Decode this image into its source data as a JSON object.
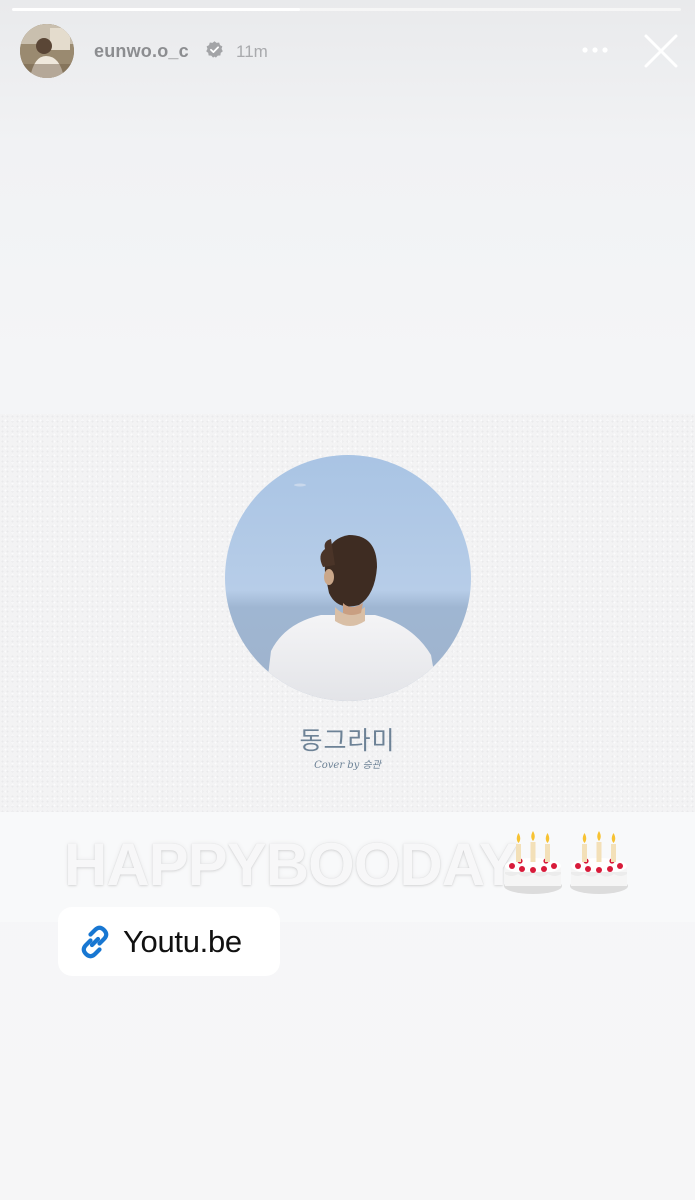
{
  "story": {
    "progress": 0.43
  },
  "header": {
    "username": "eunwo.o_c",
    "timestamp": "11m",
    "verified_icon": "verified-badge-icon",
    "more_icon": "more-horizontal-icon",
    "close_icon": "close-icon"
  },
  "shared_post": {
    "song_title": "동그라미",
    "song_credit": "Cover by 승관"
  },
  "caption": {
    "text": "HAPPYBOODAY",
    "emoji": [
      "birthday-cake-icon",
      "birthday-cake-icon"
    ]
  },
  "link_sticker": {
    "label": "Youtu.be",
    "icon": "link-icon",
    "accent_color": "#1877d2"
  }
}
